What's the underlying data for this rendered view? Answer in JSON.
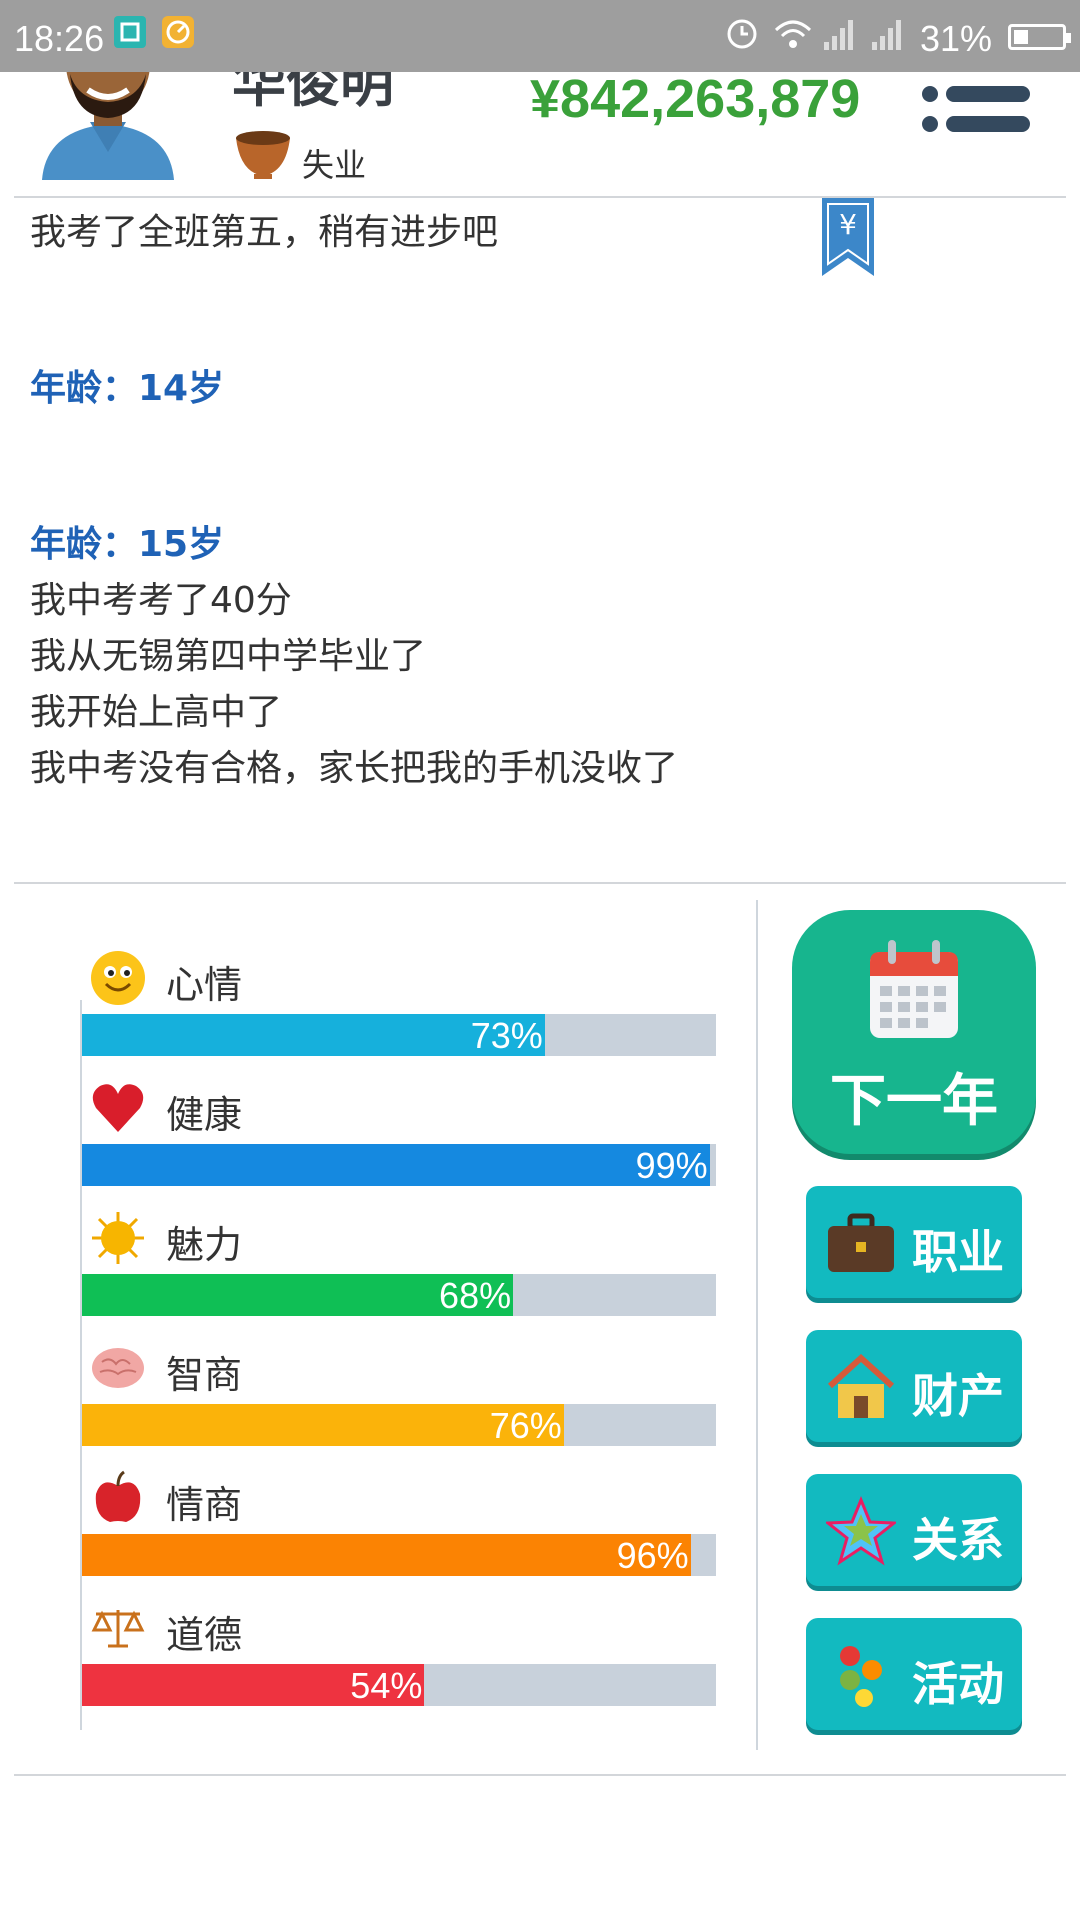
{
  "status_bar": {
    "time": "18:26",
    "battery": "31%"
  },
  "header": {
    "name": "华俊明",
    "job": "失业",
    "money": "¥842,263,879"
  },
  "log": {
    "lines": [
      {
        "text": "我考了全班第五，稍有进步吧"
      },
      {
        "text": "年龄：14岁"
      },
      {
        "text": "年龄：15岁"
      },
      {
        "text": "我中考考了40分"
      },
      {
        "text": "我从无锡第四中学毕业了"
      },
      {
        "text": "我开始上高中了"
      },
      {
        "text": "我中考没有合格，家长把我的手机没收了"
      }
    ]
  },
  "stats": [
    {
      "label": "心情",
      "value": 73,
      "pct": "73%",
      "color": "#16b0dc",
      "icon": "smiley-icon"
    },
    {
      "label": "健康",
      "value": 99,
      "pct": "99%",
      "color": "#1589e0",
      "icon": "heart-icon"
    },
    {
      "label": "魅力",
      "value": 68,
      "pct": "68%",
      "color": "#0fbf55",
      "icon": "sun-icon"
    },
    {
      "label": "智商",
      "value": 76,
      "pct": "76%",
      "color": "#fbb30a",
      "icon": "brain-icon"
    },
    {
      "label": "情商",
      "value": 96,
      "pct": "96%",
      "color": "#fb8303",
      "icon": "apple-icon"
    },
    {
      "label": "道德",
      "value": 54,
      "pct": "54%",
      "color": "#ee3340",
      "icon": "scales-icon"
    }
  ],
  "actions": {
    "next_year": "下一年",
    "career": "职业",
    "assets": "财产",
    "relations": "关系",
    "activities": "活动"
  }
}
